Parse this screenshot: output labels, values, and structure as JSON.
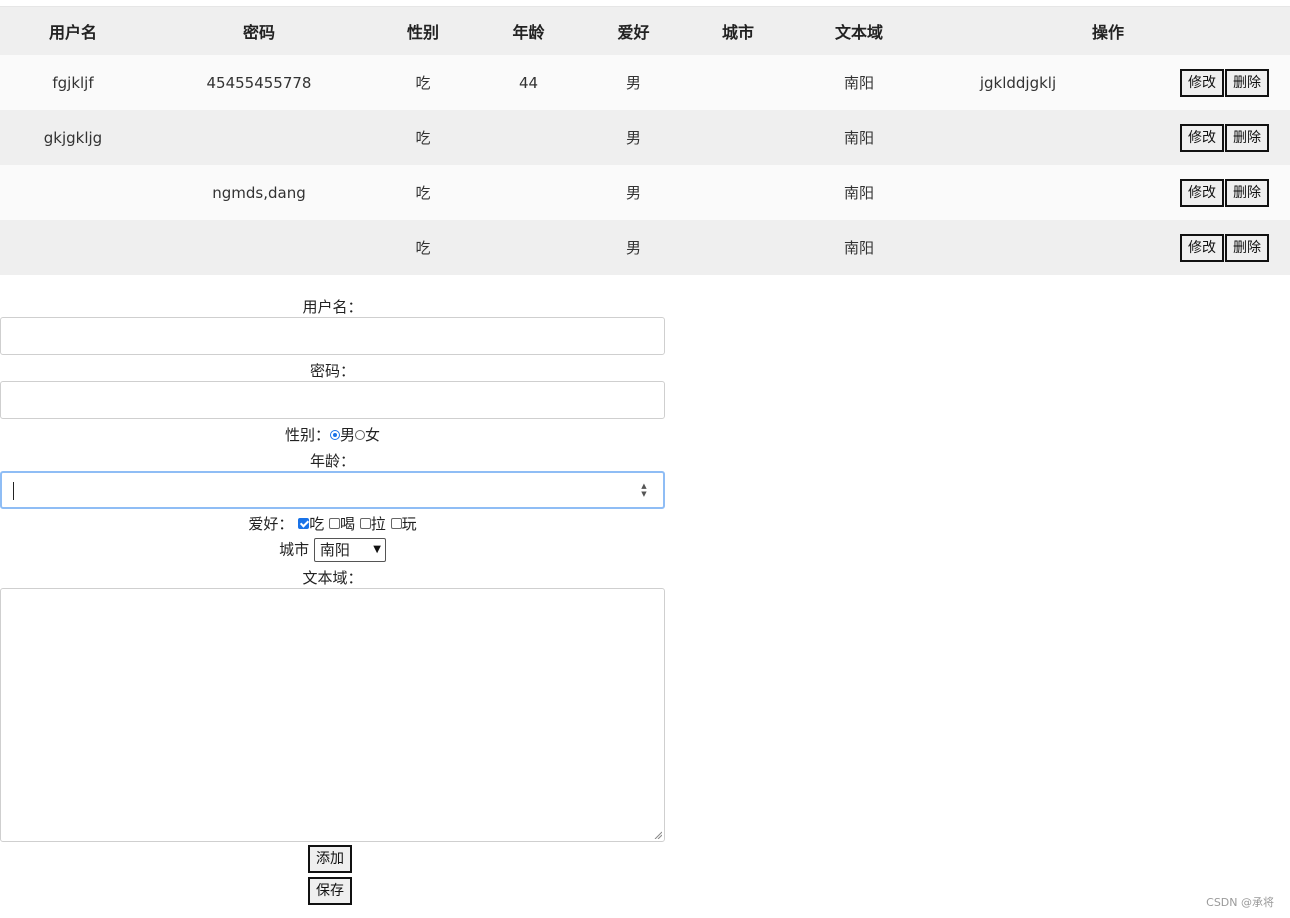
{
  "table": {
    "headers": [
      "用户名",
      "密码",
      "性别",
      "年龄",
      "爱好",
      "城市",
      "文本域",
      "操作"
    ],
    "rows": [
      {
        "c0": "fgjkljf",
        "c1": "45455455778",
        "c2": "吃",
        "c3": "44",
        "c4": "男",
        "c5": "",
        "c6": "南阳",
        "c7": "jgklddjgklj"
      },
      {
        "c0": "gkjgkljg",
        "c1": "",
        "c2": "吃",
        "c3": "",
        "c4": "男",
        "c5": "",
        "c6": "南阳",
        "c7": ""
      },
      {
        "c0": "",
        "c1": "ngmds,dang",
        "c2": "吃",
        "c3": "",
        "c4": "男",
        "c5": "",
        "c6": "南阳",
        "c7": ""
      },
      {
        "c0": "",
        "c1": "",
        "c2": "吃",
        "c3": "",
        "c4": "男",
        "c5": "",
        "c6": "南阳",
        "c7": ""
      }
    ],
    "edit_label": "修改",
    "delete_label": "删除"
  },
  "form": {
    "username_label": "用户名：",
    "username_value": "",
    "password_label": "密码：",
    "password_value": "",
    "gender_label": "性别：",
    "gender_options": [
      "男",
      "女"
    ],
    "gender_selected": "男",
    "age_label": "年龄：",
    "age_value": "",
    "hobby_label": "爱好：",
    "hobby_options": [
      "吃",
      "喝",
      "拉",
      "玩"
    ],
    "hobby_checked": [
      "吃"
    ],
    "city_label": "城市",
    "city_selected": "南阳",
    "textarea_label": "文本域：",
    "textarea_value": "",
    "add_label": "添加",
    "save_label": "保存"
  },
  "watermark": "CSDN @承将",
  "colors": {
    "header_bg": "#efefef",
    "row_alt_bg": "#efefef",
    "focus_border": "#8fbdf5",
    "accent": "#1a73e8"
  }
}
